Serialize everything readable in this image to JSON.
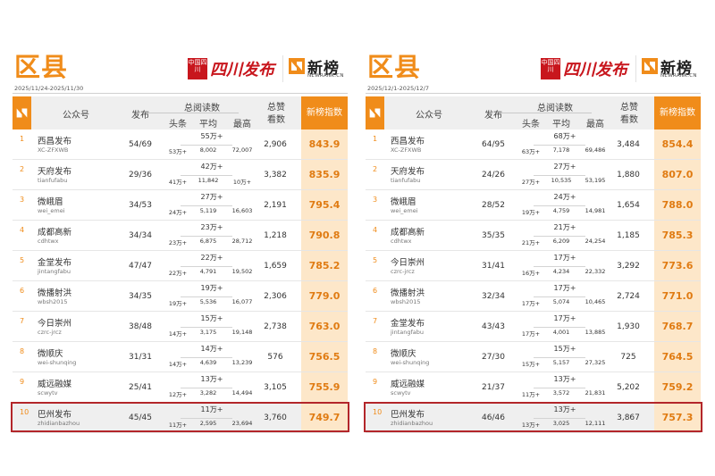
{
  "header_labels": {
    "account": "公众号",
    "publish": "发布",
    "reads": "总阅读数",
    "head": "头条",
    "avg": "平均",
    "max": "最高",
    "likes": "总赞看数",
    "score": "新榜指数"
  },
  "brands": {
    "sichuan": "四川发布",
    "sichuan_seal": "中国四川",
    "newrank": "新榜",
    "newrank_sub": "NEWRANK.CN"
  },
  "colors": {
    "accent": "#f08c1a",
    "highlight_border": "#b3262a",
    "brand_red": "#c8161d"
  },
  "panels": [
    {
      "region": "区县",
      "date": "2025/11/24-2025/11/30",
      "rows": [
        {
          "rank": "1",
          "name": "西昌发布",
          "acct": "XC-ZFXWB",
          "pub": "54/69",
          "total": "55万+",
          "head": "53万+",
          "avg": "8,002",
          "max": "72,007",
          "likes": "2,906",
          "score": "843.9"
        },
        {
          "rank": "2",
          "name": "天府发布",
          "acct": "tianfufabu",
          "pub": "29/36",
          "total": "42万+",
          "head": "41万+",
          "avg": "11,842",
          "max": "10万+",
          "likes": "3,382",
          "score": "835.9"
        },
        {
          "rank": "3",
          "name": "微峨眉",
          "acct": "wei_emei",
          "pub": "34/53",
          "total": "27万+",
          "head": "24万+",
          "avg": "5,119",
          "max": "16,603",
          "likes": "2,191",
          "score": "795.4"
        },
        {
          "rank": "4",
          "name": "成都高新",
          "acct": "cdhtwx",
          "pub": "34/34",
          "total": "23万+",
          "head": "23万+",
          "avg": "6,875",
          "max": "28,712",
          "likes": "1,218",
          "score": "790.8"
        },
        {
          "rank": "5",
          "name": "金堂发布",
          "acct": "jintangfabu",
          "pub": "47/47",
          "total": "22万+",
          "head": "22万+",
          "avg": "4,791",
          "max": "19,502",
          "likes": "1,659",
          "score": "785.2"
        },
        {
          "rank": "6",
          "name": "微播射洪",
          "acct": "wbsh2015",
          "pub": "34/35",
          "total": "19万+",
          "head": "19万+",
          "avg": "5,536",
          "max": "16,077",
          "likes": "2,306",
          "score": "779.0"
        },
        {
          "rank": "7",
          "name": "今日崇州",
          "acct": "czrc-jrcz",
          "pub": "38/48",
          "total": "15万+",
          "head": "14万+",
          "avg": "3,175",
          "max": "19,148",
          "likes": "2,738",
          "score": "763.0"
        },
        {
          "rank": "8",
          "name": "微顺庆",
          "acct": "wei-shunqing",
          "pub": "31/31",
          "total": "14万+",
          "head": "14万+",
          "avg": "4,639",
          "max": "13,239",
          "likes": "576",
          "score": "756.5"
        },
        {
          "rank": "9",
          "name": "威远融媒",
          "acct": "scwytv",
          "pub": "25/41",
          "total": "13万+",
          "head": "12万+",
          "avg": "3,282",
          "max": "14,494",
          "likes": "3,105",
          "score": "755.9"
        },
        {
          "rank": "10",
          "name": "巴州发布",
          "acct": "zhidianbazhou",
          "pub": "45/45",
          "total": "11万+",
          "head": "11万+",
          "avg": "2,595",
          "max": "23,694",
          "likes": "3,760",
          "score": "749.7",
          "highlight": true
        }
      ]
    },
    {
      "region": "区县",
      "date": "2025/12/1-2025/12/7",
      "rows": [
        {
          "rank": "1",
          "name": "西昌发布",
          "acct": "XC-ZFXWB",
          "pub": "64/95",
          "total": "68万+",
          "head": "63万+",
          "avg": "7,178",
          "max": "69,486",
          "likes": "3,484",
          "score": "854.4"
        },
        {
          "rank": "2",
          "name": "天府发布",
          "acct": "tianfufabu",
          "pub": "24/26",
          "total": "27万+",
          "head": "27万+",
          "avg": "10,535",
          "max": "53,195",
          "likes": "1,880",
          "score": "807.0"
        },
        {
          "rank": "3",
          "name": "微峨眉",
          "acct": "wei_emei",
          "pub": "28/52",
          "total": "24万+",
          "head": "19万+",
          "avg": "4,759",
          "max": "14,981",
          "likes": "1,654",
          "score": "788.0"
        },
        {
          "rank": "4",
          "name": "成都高新",
          "acct": "cdhtwx",
          "pub": "35/35",
          "total": "21万+",
          "head": "21万+",
          "avg": "6,209",
          "max": "24,254",
          "likes": "1,185",
          "score": "785.3"
        },
        {
          "rank": "5",
          "name": "今日崇州",
          "acct": "czrc-jrcz",
          "pub": "31/41",
          "total": "17万+",
          "head": "16万+",
          "avg": "4,234",
          "max": "22,332",
          "likes": "3,292",
          "score": "773.6"
        },
        {
          "rank": "6",
          "name": "微播射洪",
          "acct": "wbsh2015",
          "pub": "32/34",
          "total": "17万+",
          "head": "17万+",
          "avg": "5,074",
          "max": "10,465",
          "likes": "2,724",
          "score": "771.0"
        },
        {
          "rank": "7",
          "name": "金堂发布",
          "acct": "jintangfabu",
          "pub": "43/43",
          "total": "17万+",
          "head": "17万+",
          "avg": "4,001",
          "max": "13,885",
          "likes": "1,930",
          "score": "768.7"
        },
        {
          "rank": "8",
          "name": "微顺庆",
          "acct": "wei-shunqing",
          "pub": "27/30",
          "total": "15万+",
          "head": "15万+",
          "avg": "5,157",
          "max": "27,325",
          "likes": "725",
          "score": "764.5"
        },
        {
          "rank": "9",
          "name": "威远融媒",
          "acct": "scwytv",
          "pub": "21/37",
          "total": "13万+",
          "head": "11万+",
          "avg": "3,572",
          "max": "21,831",
          "likes": "5,202",
          "score": "759.2"
        },
        {
          "rank": "10",
          "name": "巴州发布",
          "acct": "zhidianbazhou",
          "pub": "46/46",
          "total": "13万+",
          "head": "13万+",
          "avg": "3,025",
          "max": "12,111",
          "likes": "3,867",
          "score": "757.3",
          "highlight": true
        }
      ]
    }
  ]
}
